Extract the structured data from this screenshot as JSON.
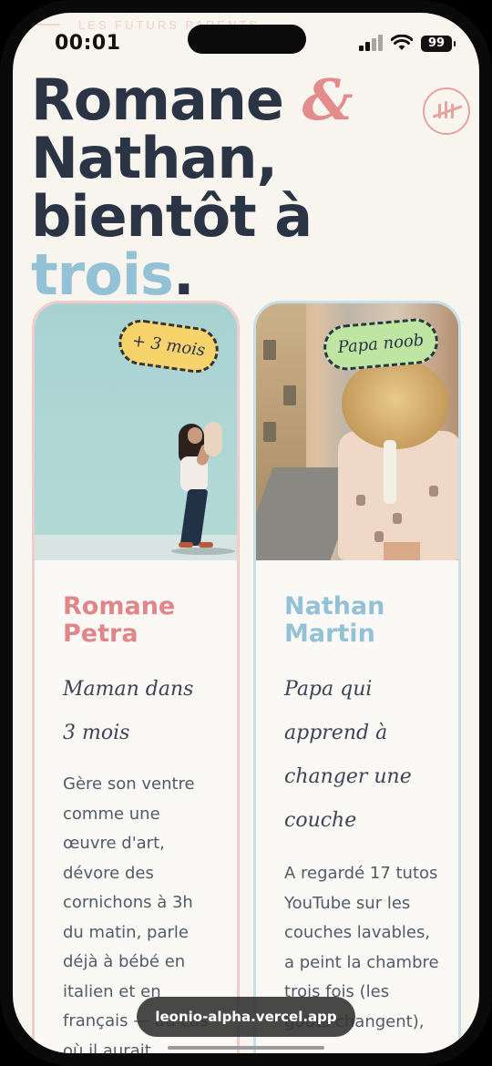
{
  "status_bar": {
    "time": "00:01",
    "battery": "99",
    "ghost_header": "LES FUTURS PARENTS"
  },
  "hero": {
    "line1": "Romane",
    "amp": "&",
    "line2": "Nathan,",
    "line3_start": "bientôt à",
    "line3_accent": "trois",
    "line3_end": "."
  },
  "cards": [
    {
      "sticker": "+ 3 mois",
      "first_name": "Romane",
      "last_name": "Petra",
      "role_line1": "Maman dans",
      "role_line2": "3 mois",
      "description": "Gère son ventre comme une œuvre d'art, dévore des cornichons à 3h du matin, parle déjà à bébé en italien et en français — au cas où il aurait"
    },
    {
      "sticker": "Papa noob",
      "first_name": "Nathan",
      "last_name": "Martin",
      "role_line1": "Papa qui",
      "role_line2": "apprend à",
      "role_line3": "changer une",
      "role_line4": "couche",
      "description": "A regardé 17 tutos YouTube sur les couches lavables, a peint la chambre trois fois (les goûts changent),"
    }
  ],
  "browser": {
    "url": "leonio-alpha.vercel.app"
  },
  "colors": {
    "background": "#f8f4ee",
    "navy": "#2b3445",
    "pink": "#e0868a",
    "blue": "#93c1d6"
  }
}
